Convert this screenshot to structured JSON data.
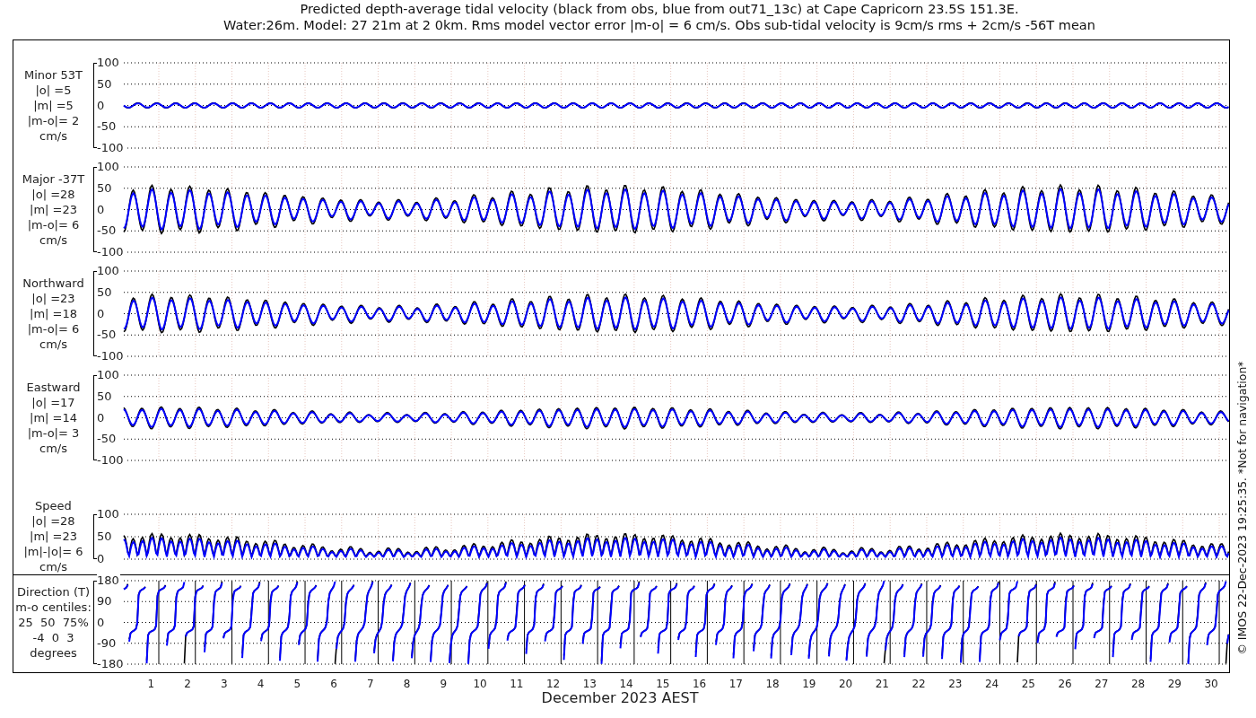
{
  "title_lines": [
    "Predicted depth-average tidal velocity (black from obs, blue from out71_13c) at Cape Capricorn 23.5S 151.3E.",
    "Water:26m. Model: 27 21m at 2 0km. Rms model vector error |m-o| = 6 cm/s. Obs sub-tidal velocity is 9cm/s rms + 2cm/s -56T mean"
  ],
  "panels": [
    {
      "kind": "signed",
      "label_lines": [
        "Minor 53T",
        "|o| =5",
        "|m| =5",
        "|m-o|= 2",
        "cm/s"
      ],
      "yticks": [
        "100",
        "50",
        "0",
        "-50",
        "-100"
      ]
    },
    {
      "kind": "signed",
      "label_lines": [
        "Major -37T",
        "|o| =28",
        "|m| =23",
        "|m-o|= 6",
        "cm/s"
      ],
      "yticks": [
        "100",
        "50",
        "0",
        "-50",
        "-100"
      ]
    },
    {
      "kind": "signed",
      "label_lines": [
        "Northward",
        "|o| =23",
        "|m| =18",
        "|m-o|= 6",
        "cm/s"
      ],
      "yticks": [
        "100",
        "50",
        "0",
        "-50",
        "-100"
      ]
    },
    {
      "kind": "signed",
      "label_lines": [
        "Eastward",
        "|o| =17",
        "|m| =14",
        "|m-o|= 3",
        "cm/s"
      ],
      "yticks": [
        "100",
        "50",
        "0",
        "-50",
        "-100"
      ]
    },
    {
      "kind": "speed",
      "label_lines": [
        "Speed",
        "|o| =28",
        "|m| =23",
        "|m|-|o|= 6",
        "cm/s"
      ],
      "yticks": [
        "100",
        "50",
        "0"
      ]
    },
    {
      "kind": "direction",
      "label_lines": [
        "Direction (T)",
        "m-o centiles:",
        "25  50  75%",
        "-4  0  3",
        "degrees"
      ],
      "yticks": [
        "180",
        "90",
        "0",
        "-90",
        "-180"
      ]
    }
  ],
  "x_axis": {
    "day_labels": [
      "1",
      "2",
      "3",
      "4",
      "5",
      "6",
      "7",
      "8",
      "9",
      "10",
      "11",
      "12",
      "13",
      "14",
      "15",
      "16",
      "17",
      "18",
      "19",
      "20",
      "21",
      "22",
      "23",
      "24",
      "25",
      "26",
      "27",
      "28",
      "29",
      "30"
    ],
    "label": "December 2023 AEST"
  },
  "credit": "© IMOS 22-Dec-2023 19:25:35. *Not for navigation*"
}
